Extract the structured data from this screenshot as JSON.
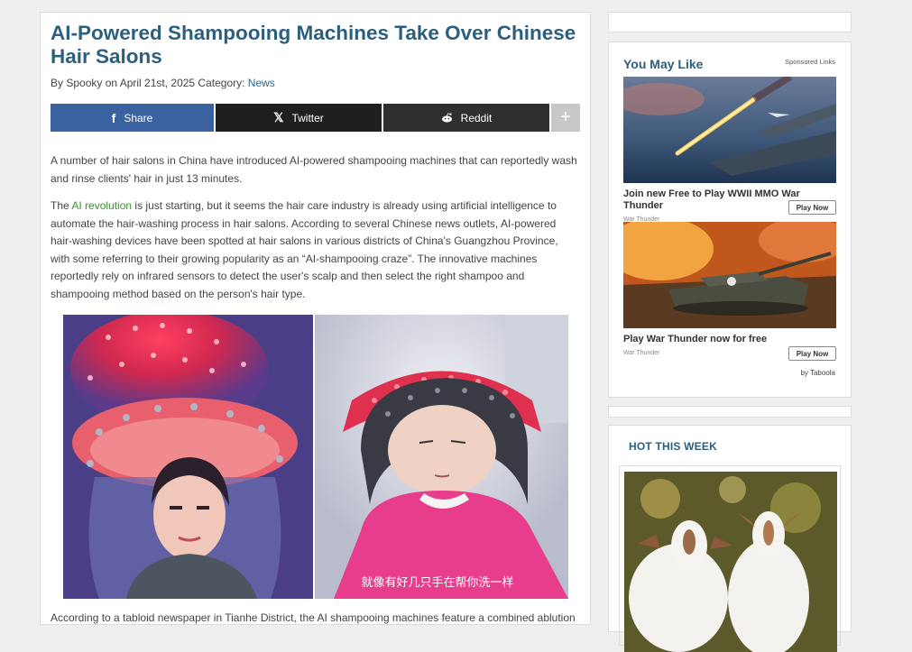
{
  "article": {
    "title": "AI-Powered Shampooing Machines Take Over Chinese Hair Salons",
    "byline_prefix": "By Spooky on April 21st, 2025 Category: ",
    "category": "News",
    "share": {
      "facebook": "Share",
      "twitter": "Twitter",
      "reddit": "Reddit",
      "more": "+"
    },
    "p1": "A number of hair salons in China have introduced AI-powered shampooing machines that can reportedly wash and rinse clients' hair in just 13 minutes.",
    "p2_before": "The ",
    "p2_link": "AI revolution",
    "p2_after": " is just starting, but it seems the hair care industry is already using artificial intelligence to automate the hair-washing process in hair salons. According to several Chinese news outlets, AI-powered hair-washing devices have been spotted at hair salons in various districts of China's Guangzhou Province, with some referring to their growing popularity as an “AI-shampooing craze”. The innovative machines reportedly rely on infrared sensors to detect the user's scalp and then select the right shampoo and shampooing method based on the person's hair type.",
    "photo_caption": "就像有好几只手在帮你洗一样",
    "p3": "According to a tabloid newspaper in Tianhe District, the AI shampooing machines feature a combined ablution"
  },
  "sidebar": {
    "ads_title": "You May Like",
    "sponsored": "Sponsored Links",
    "ads": [
      {
        "caption": "Join new Free to Play WWII MMO War Thunder",
        "source": "War Thunder",
        "button": "Play Now"
      },
      {
        "caption": "Play War Thunder now for free",
        "source": "War Thunder",
        "button": "Play Now"
      }
    ],
    "by_taboola": "by Taboola",
    "hot_title": "HOT THIS WEEK"
  },
  "colors": {
    "title": "#2c5f7e",
    "facebook": "#3b62a0",
    "twitter": "#1f1f1f",
    "reddit": "#2f2f2f",
    "link_green": "#3a9132",
    "link_blue": "#2a6496"
  }
}
